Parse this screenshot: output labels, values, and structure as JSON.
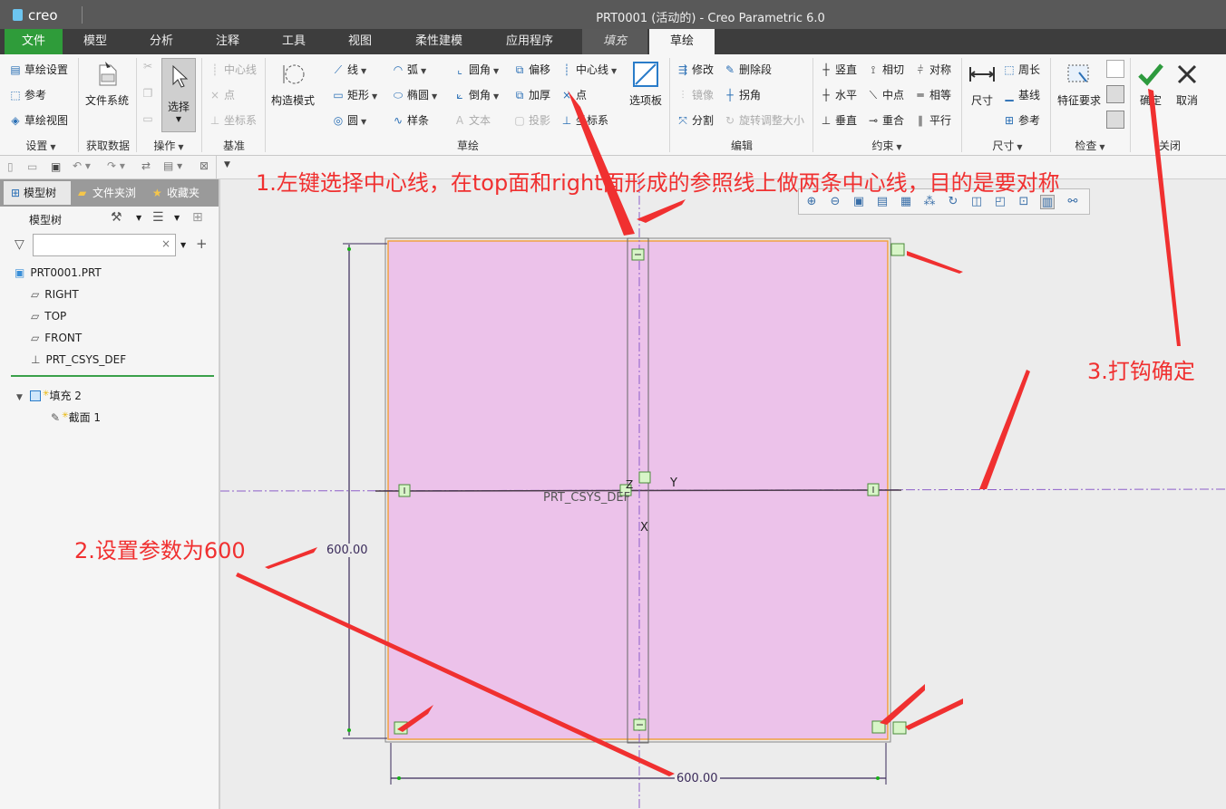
{
  "titlebar": {
    "logo": "creo",
    "title": "PRT0001 (活动的) - Creo Parametric 6.0"
  },
  "tabs": [
    "文件",
    "模型",
    "分析",
    "注释",
    "工具",
    "视图",
    "柔性建模",
    "应用程序",
    "填充",
    "草绘"
  ],
  "ribbon": {
    "settings": {
      "items": [
        "草绘设置",
        "参考",
        "草绘视图"
      ],
      "label": "设置"
    },
    "getdata": {
      "button": "文件系统",
      "label": "获取数据"
    },
    "operations": {
      "select": "选择",
      "label": "操作"
    },
    "datum": {
      "items": [
        "中心线",
        "点",
        "坐标系"
      ],
      "label": "基准"
    },
    "sketch": {
      "construct_mode": "构造模式",
      "col1": [
        "线",
        "矩形",
        "圆"
      ],
      "col2": [
        "弧",
        "椭圆",
        "样条"
      ],
      "col3": [
        "圆角",
        "倒角",
        "文本"
      ],
      "col4": [
        "偏移",
        "加厚",
        "投影"
      ],
      "col5": [
        "中心线",
        "点",
        "坐标系"
      ],
      "palette": "选项板",
      "label": "草绘"
    },
    "edit": {
      "col1": [
        "修改",
        "镜像",
        "分割"
      ],
      "col2": [
        "删除段",
        "拐角",
        "旋转调整大小"
      ],
      "label": "编辑"
    },
    "constrain": {
      "col1": [
        "竖直",
        "水平",
        "垂直"
      ],
      "col2": [
        "相切",
        "中点",
        "重合"
      ],
      "col3": [
        "对称",
        "相等",
        "平行"
      ],
      "label": "约束"
    },
    "dimension": {
      "button": "尺寸",
      "items": [
        "周长",
        "基线",
        "参考"
      ],
      "label": "尺寸"
    },
    "inspect": {
      "button": "特征要求",
      "label": "检查"
    },
    "close": {
      "ok": "确定",
      "cancel": "取消",
      "label": "关闭"
    }
  },
  "leftpanel": {
    "tabs": [
      "模型树",
      "文件夹浏",
      "收藏夹"
    ],
    "tree_title": "模型树",
    "search_placeholder": "",
    "items": [
      "PRT0001.PRT",
      "RIGHT",
      "TOP",
      "FRONT",
      "PRT_CSYS_DEF"
    ],
    "feature": "填充 2",
    "section": "截面 1"
  },
  "canvas": {
    "csys_label": "PRT_CSYS_DEF",
    "axis_z": "Z",
    "axis_y": "Y",
    "axis_x": "X",
    "dim_vertical": "600.00",
    "dim_horizontal": "600.00"
  },
  "annotations": {
    "step1": "1.左键选择中心线，在top面和right面形成的参照线上做两条中心线，目的是要对称",
    "step2": "2.设置参数为600",
    "step3": "3.打钩确定"
  },
  "colors": {
    "accent_green": "#2f9c3a",
    "fill_pink": "#ecc2ea",
    "annotation_red": "#f03030",
    "title_bg": "#595959"
  }
}
